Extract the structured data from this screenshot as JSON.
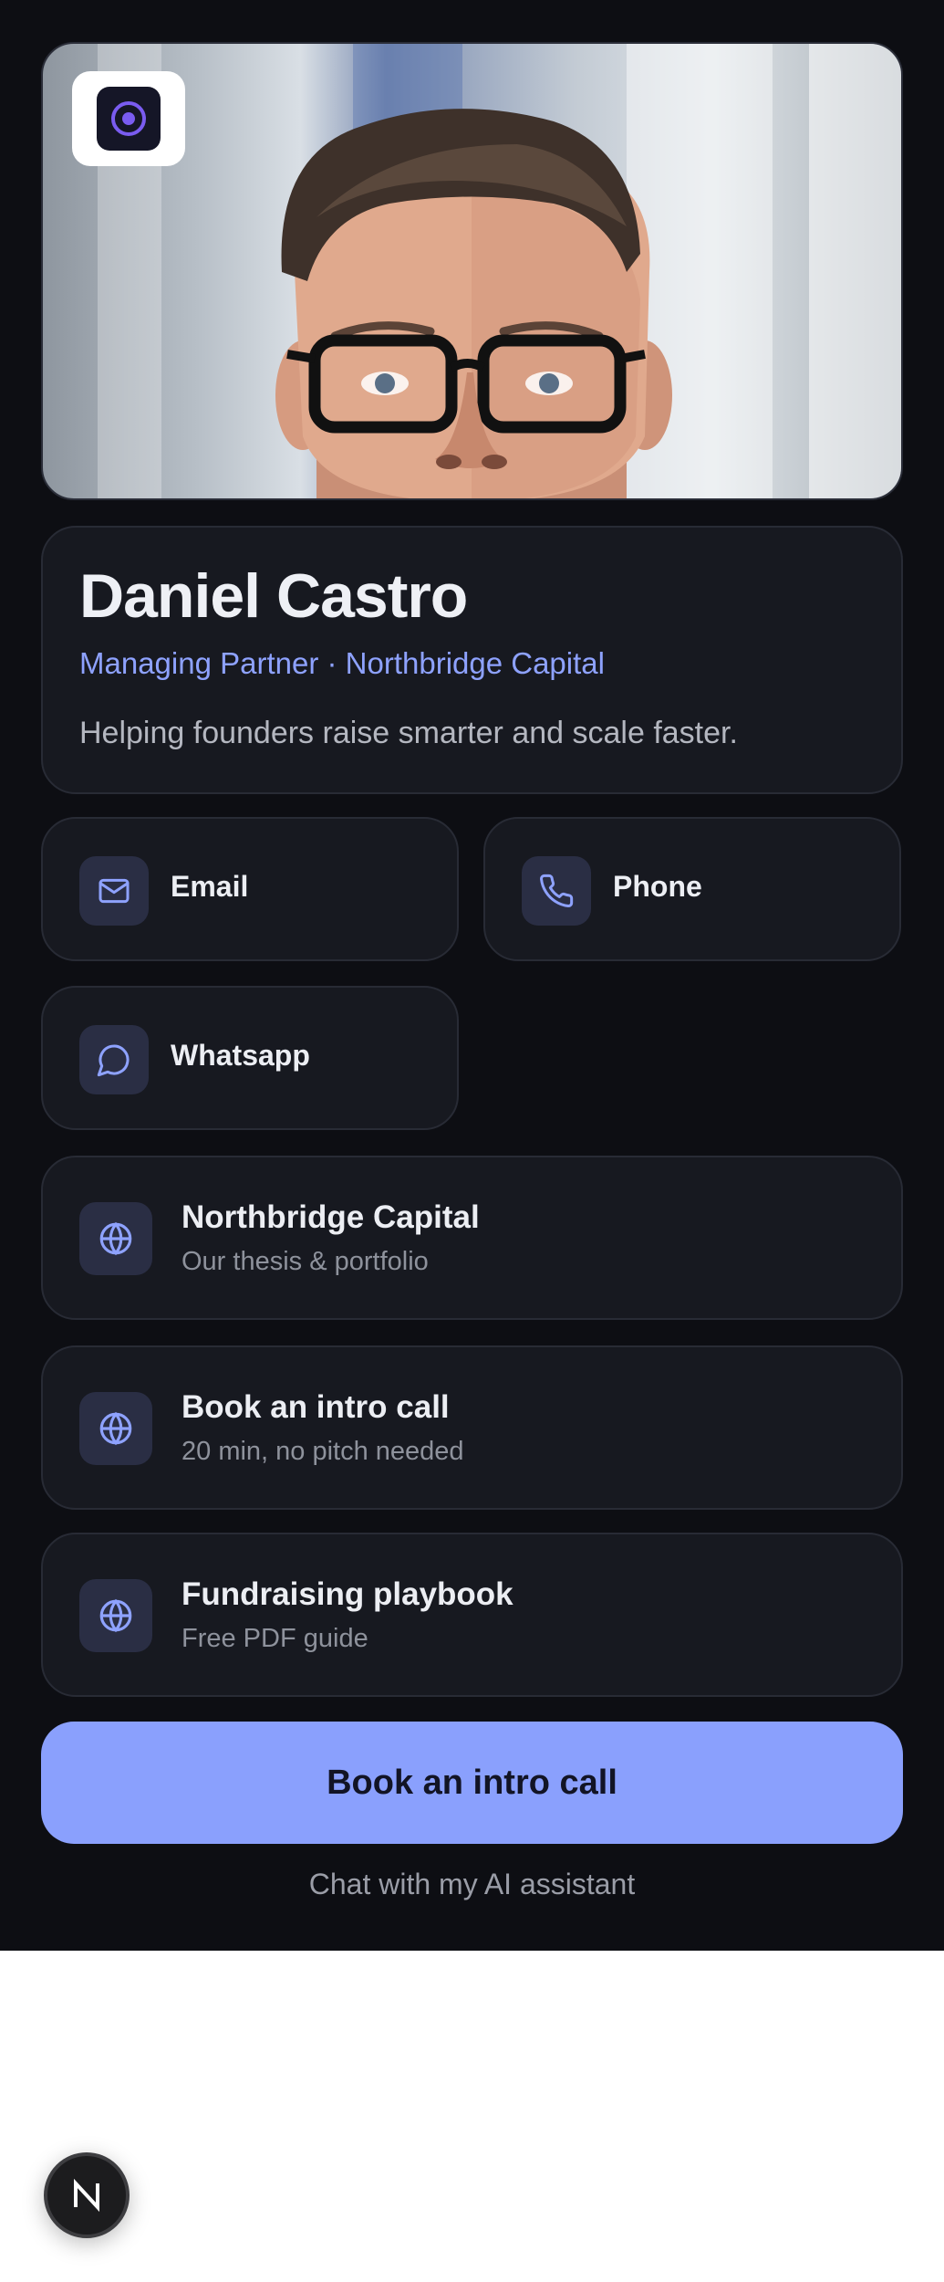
{
  "profile": {
    "name": "Daniel Castro",
    "role": "Managing Partner · Northbridge Capital",
    "tagline": "Helping founders raise smarter and scale faster."
  },
  "contacts": {
    "email": {
      "label": "Email",
      "icon": "mail-icon"
    },
    "phone": {
      "label": "Phone",
      "icon": "phone-icon"
    },
    "whatsapp": {
      "label": "Whatsapp",
      "icon": "chat-bubble-icon"
    }
  },
  "links": [
    {
      "title": "Northbridge Capital",
      "subtitle": "Our thesis & portfolio",
      "icon": "globe-icon"
    },
    {
      "title": "Book an intro call",
      "subtitle": "20 min, no pitch needed",
      "icon": "globe-icon"
    },
    {
      "title": "Fundraising playbook",
      "subtitle": "Free PDF guide",
      "icon": "globe-icon"
    }
  ],
  "cta": {
    "label": "Book an intro call"
  },
  "assistant_link": {
    "label": "Chat with my AI assistant"
  },
  "colors": {
    "background": "#0d0e13",
    "card": "#171920",
    "accent": "#8aa0fd",
    "icon_tile": "#2a2e44"
  }
}
